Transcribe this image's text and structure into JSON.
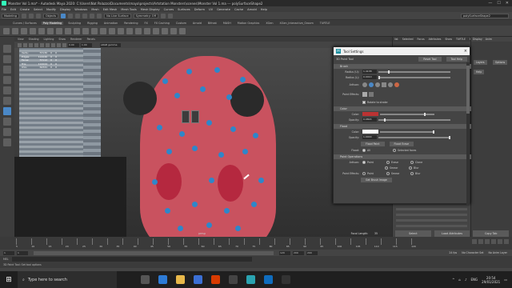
{
  "window": {
    "title": "Monster Vol 1.ma* - Autodesk Maya 2020: C:\\Users\\Nat Palazzo\\Documents\\maya\\projects\\Artstation Monsters\\scenes\\Monster Vol 1.ma --- polySurfaceShape2",
    "minimize": "—",
    "maximize": "☐",
    "close": "✕"
  },
  "menus": [
    "File",
    "Edit",
    "Create",
    "Select",
    "Modify",
    "Display",
    "Windows",
    "Mesh",
    "Edit Mesh",
    "Mesh Tools",
    "Mesh Display",
    "Curves",
    "Surfaces",
    "Deform",
    "UV",
    "Generate",
    "Cache",
    "Arnold",
    "Help"
  ],
  "statusline": {
    "workspace": "Modeling",
    "objects_field": "Objects",
    "symmetry": "Symmetry: Off",
    "live_surface": "No Live Surface",
    "search_field": "polySurfaceShape2"
  },
  "shelf_tabs": [
    "Curves / Surfaces",
    "Poly Modeling",
    "Sculpting",
    "Rigging",
    "Animation",
    "Rendering",
    "FX",
    "FX Caching",
    "Custom",
    "Arnold",
    "Bifrost",
    "MASH",
    "Motion Graphics",
    "XGen",
    "XGen_Interactive_Groom",
    "TURTLE"
  ],
  "shelf_active": "Poly Modeling",
  "viewport": {
    "menus": [
      "View",
      "Shading",
      "Lighting",
      "Show",
      "Renderer",
      "Panels"
    ],
    "field_a": "0.00",
    "field_b": "1.00",
    "colorspace": "sRGB gamma",
    "hud_rows": [
      {
        "label": "Verts:",
        "a": "57130",
        "b": "0",
        "c": "0"
      },
      {
        "label": "Edges:",
        "a": "114240",
        "b": "0",
        "c": "0"
      },
      {
        "label": "Faces:",
        "a": "57112",
        "b": "0",
        "c": "0"
      },
      {
        "label": "Tris:",
        "a": "114224",
        "b": "0",
        "c": "0"
      },
      {
        "label": "UVs:",
        "a": "62341",
        "b": "0",
        "c": "0"
      }
    ],
    "camera": "persp",
    "focal_label": "Focal Length:",
    "focal_value": "35"
  },
  "tool_settings": {
    "title": "Tool Settings",
    "close": "×",
    "tool_name": "3D Paint Tool",
    "reset_button": "Reset Tool",
    "help_button": "Tool Help",
    "sections": {
      "brush": "Brush",
      "color": "Color",
      "flood": "Flood",
      "paint_operations": "Paint Operations"
    },
    "radius_u_label": "Radius (U):",
    "radius_u_value": "1.4138",
    "radius_l_label": "Radius (L):",
    "radius_l_value": "0.0010",
    "artisan_label": "Artisan:",
    "paint_effects_label": "Paint Effects:",
    "rotate_to_stroke": "Rotate to stroke",
    "color_label": "Color:",
    "opacity_label": "Opacity:",
    "opacity_value": "0.0824",
    "flood_color_label": "Color:",
    "flood_opacity_label": "Opacity:",
    "flood_opacity_value": "1.0000",
    "flood_paint_button": "Flood Paint",
    "flood_erase_button": "Flood Erase",
    "flood_mode_label": "Flood:",
    "flood_all": "All",
    "flood_selected": "Selected faces",
    "artisan_ops_label": "Artisan:",
    "paint_effects_ops_label": "Paint Effects:",
    "ops": [
      "Paint",
      "Erase",
      "Clone",
      "Smear",
      "Blur",
      "Paint",
      "Smear",
      "Blur"
    ],
    "get_brush_button": "Get Brush Image"
  },
  "attribute_editor": {
    "tabs": [
      "list",
      "Selected",
      "Focus",
      "Attributes",
      "Show",
      "TURTLE",
      "Help"
    ],
    "select_button": "Select",
    "load_attributes_button": "Load Attributes",
    "copy_tab_button": "Copy Tab"
  },
  "right_panel": {
    "tabs": [
      "Display",
      "Anim"
    ],
    "buttons": [
      "Layers",
      "Options",
      "Help"
    ]
  },
  "timeline": {
    "ticks": [
      "5",
      "10",
      "15",
      "20",
      "25",
      "30",
      "35",
      "40",
      "45",
      "50",
      "55",
      "60",
      "65",
      "70",
      "75",
      "80",
      "85",
      "90",
      "95",
      "100",
      "105",
      "110",
      "115",
      "120"
    ],
    "range_start": "1",
    "range_inner_start": "1",
    "range_inner_end": "120",
    "range_end": "120",
    "range_total": "200",
    "range_end_b": "200",
    "character_set": "No Character Set",
    "anim_layer": "No Anim Layer",
    "fps": "24 fps"
  },
  "command": {
    "mel": "MEL",
    "help_text": "3D Paint Tool: Set tool options"
  },
  "taskbar": {
    "search_placeholder": "Type here to search",
    "language": "ENG",
    "time": "20:54",
    "date": "29/01/2021"
  }
}
